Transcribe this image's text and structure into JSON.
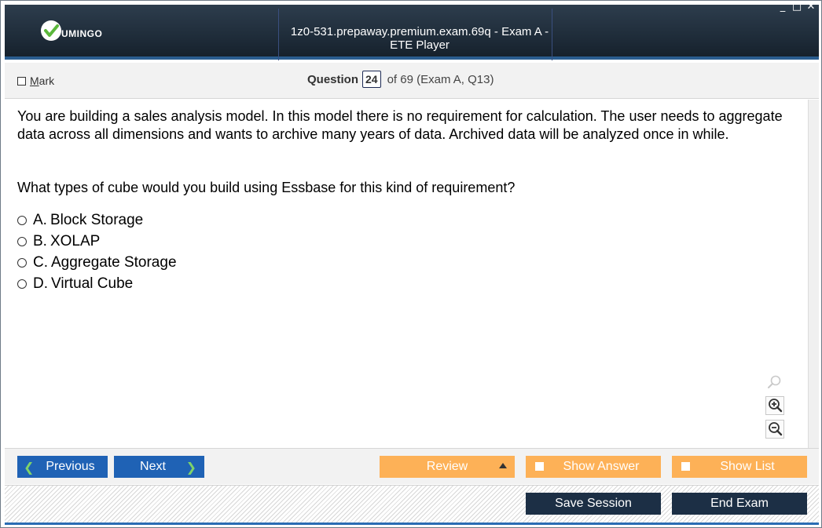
{
  "window": {
    "title": "1z0-531.prepaway.premium.exam.69q - Exam A - ETE Player",
    "controls": {
      "minimize": "_",
      "maximize": "□",
      "close": "✕"
    }
  },
  "logo": {
    "text": "UMINGO",
    "icon": "vumingo-check-icon"
  },
  "header": {
    "mark_label_first": "M",
    "mark_label_rest": "ark",
    "question_label": "Question",
    "question_number": "24",
    "question_of": "of 69 (Exam A, Q13)"
  },
  "question": {
    "text": "You are building a sales analysis model. In this model there is no requirement for calculation. The user needs to aggregate data across all dimensions and wants to archive many years of data. Archived data will be analyzed once in while.",
    "prompt": "What types of cube would you build using Essbase for this kind of requirement?",
    "answers": [
      {
        "letter": "A.",
        "text": "Block Storage"
      },
      {
        "letter": "B.",
        "text": "XOLAP"
      },
      {
        "letter": "C.",
        "text": "Aggregate Storage"
      },
      {
        "letter": "D.",
        "text": "Virtual Cube"
      }
    ]
  },
  "zoom": {
    "icons": [
      "search-icon",
      "zoom-in-icon",
      "zoom-out-icon"
    ]
  },
  "nav": {
    "previous": "Previous",
    "next": "Next",
    "review": "Review",
    "show_answer": "Show Answer",
    "show_list": "Show List"
  },
  "footer": {
    "save_session": "Save Session",
    "end_exam": "End Exam"
  },
  "colors": {
    "titlebar": "#1d2a37",
    "nav_blue": "#1f62b5",
    "nav_orange": "#fdb157",
    "footer_dark": "#1c2f45",
    "accent_line": "#2a6cb3"
  }
}
